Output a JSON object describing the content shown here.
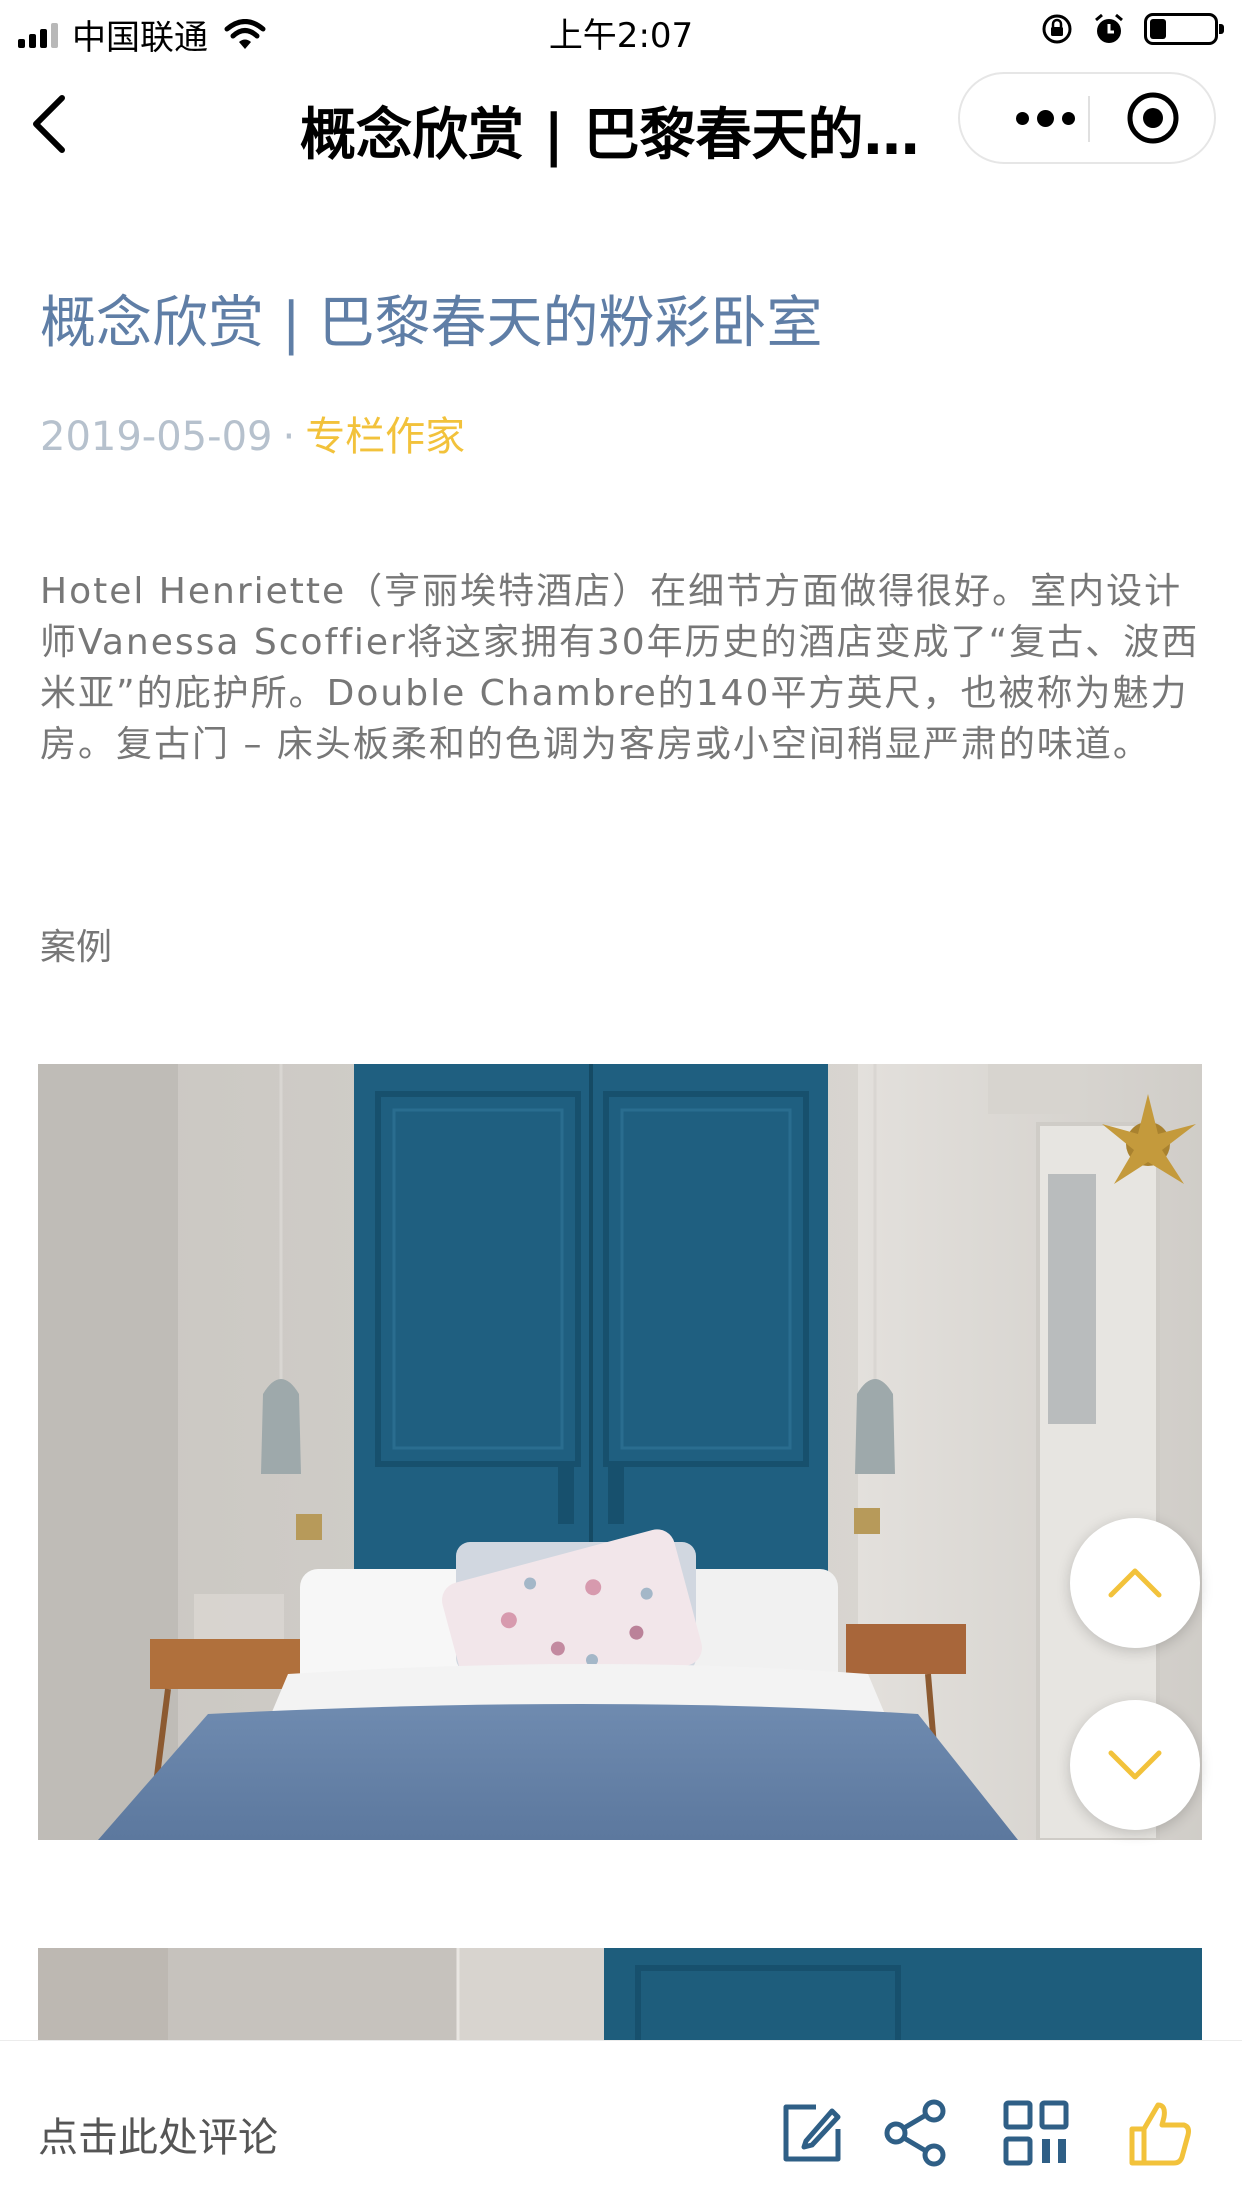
{
  "status_bar": {
    "carrier": "中国联通",
    "time": "上午2:07",
    "battery_level": 0.26,
    "icons": [
      "signal-icon",
      "wifi-icon",
      "rotation-lock-icon",
      "alarm-icon",
      "battery-icon"
    ]
  },
  "nav": {
    "title": "概念欣赏 | 巴黎春天的粉彩卧室",
    "icons": [
      "back-icon",
      "more-icon",
      "close-miniprogram-icon"
    ]
  },
  "article": {
    "title": "概念欣赏 | 巴黎春天的粉彩卧室",
    "date": "2019-05-09",
    "separator": "·",
    "author": "专栏作家",
    "body": "Hotel Henriette（亨丽埃特酒店）在细节方面做得很好。室内设计师Vanessa Scoffier将这家拥有30年历史的酒店变成了“复古、波西米亚”的庇护所。Double Chambre的140平方英尺，也被称为魅力房。复古门 – 床头板柔和的色调为客房或小空间稍显严肃的味道。",
    "section_label": "案例"
  },
  "bottom_bar": {
    "comment_placeholder": "点击此处评论",
    "icons": [
      "edit-icon",
      "share-icon",
      "qrcode-icon",
      "like-icon"
    ]
  },
  "colors": {
    "title_blue": "#5f7ea6",
    "accent_yellow": "#f2c23b",
    "meta_gray": "#b6c1cd",
    "body_gray": "#777777",
    "door_teal": "#1f5f80",
    "blanket_blue": "#6b86ab"
  }
}
